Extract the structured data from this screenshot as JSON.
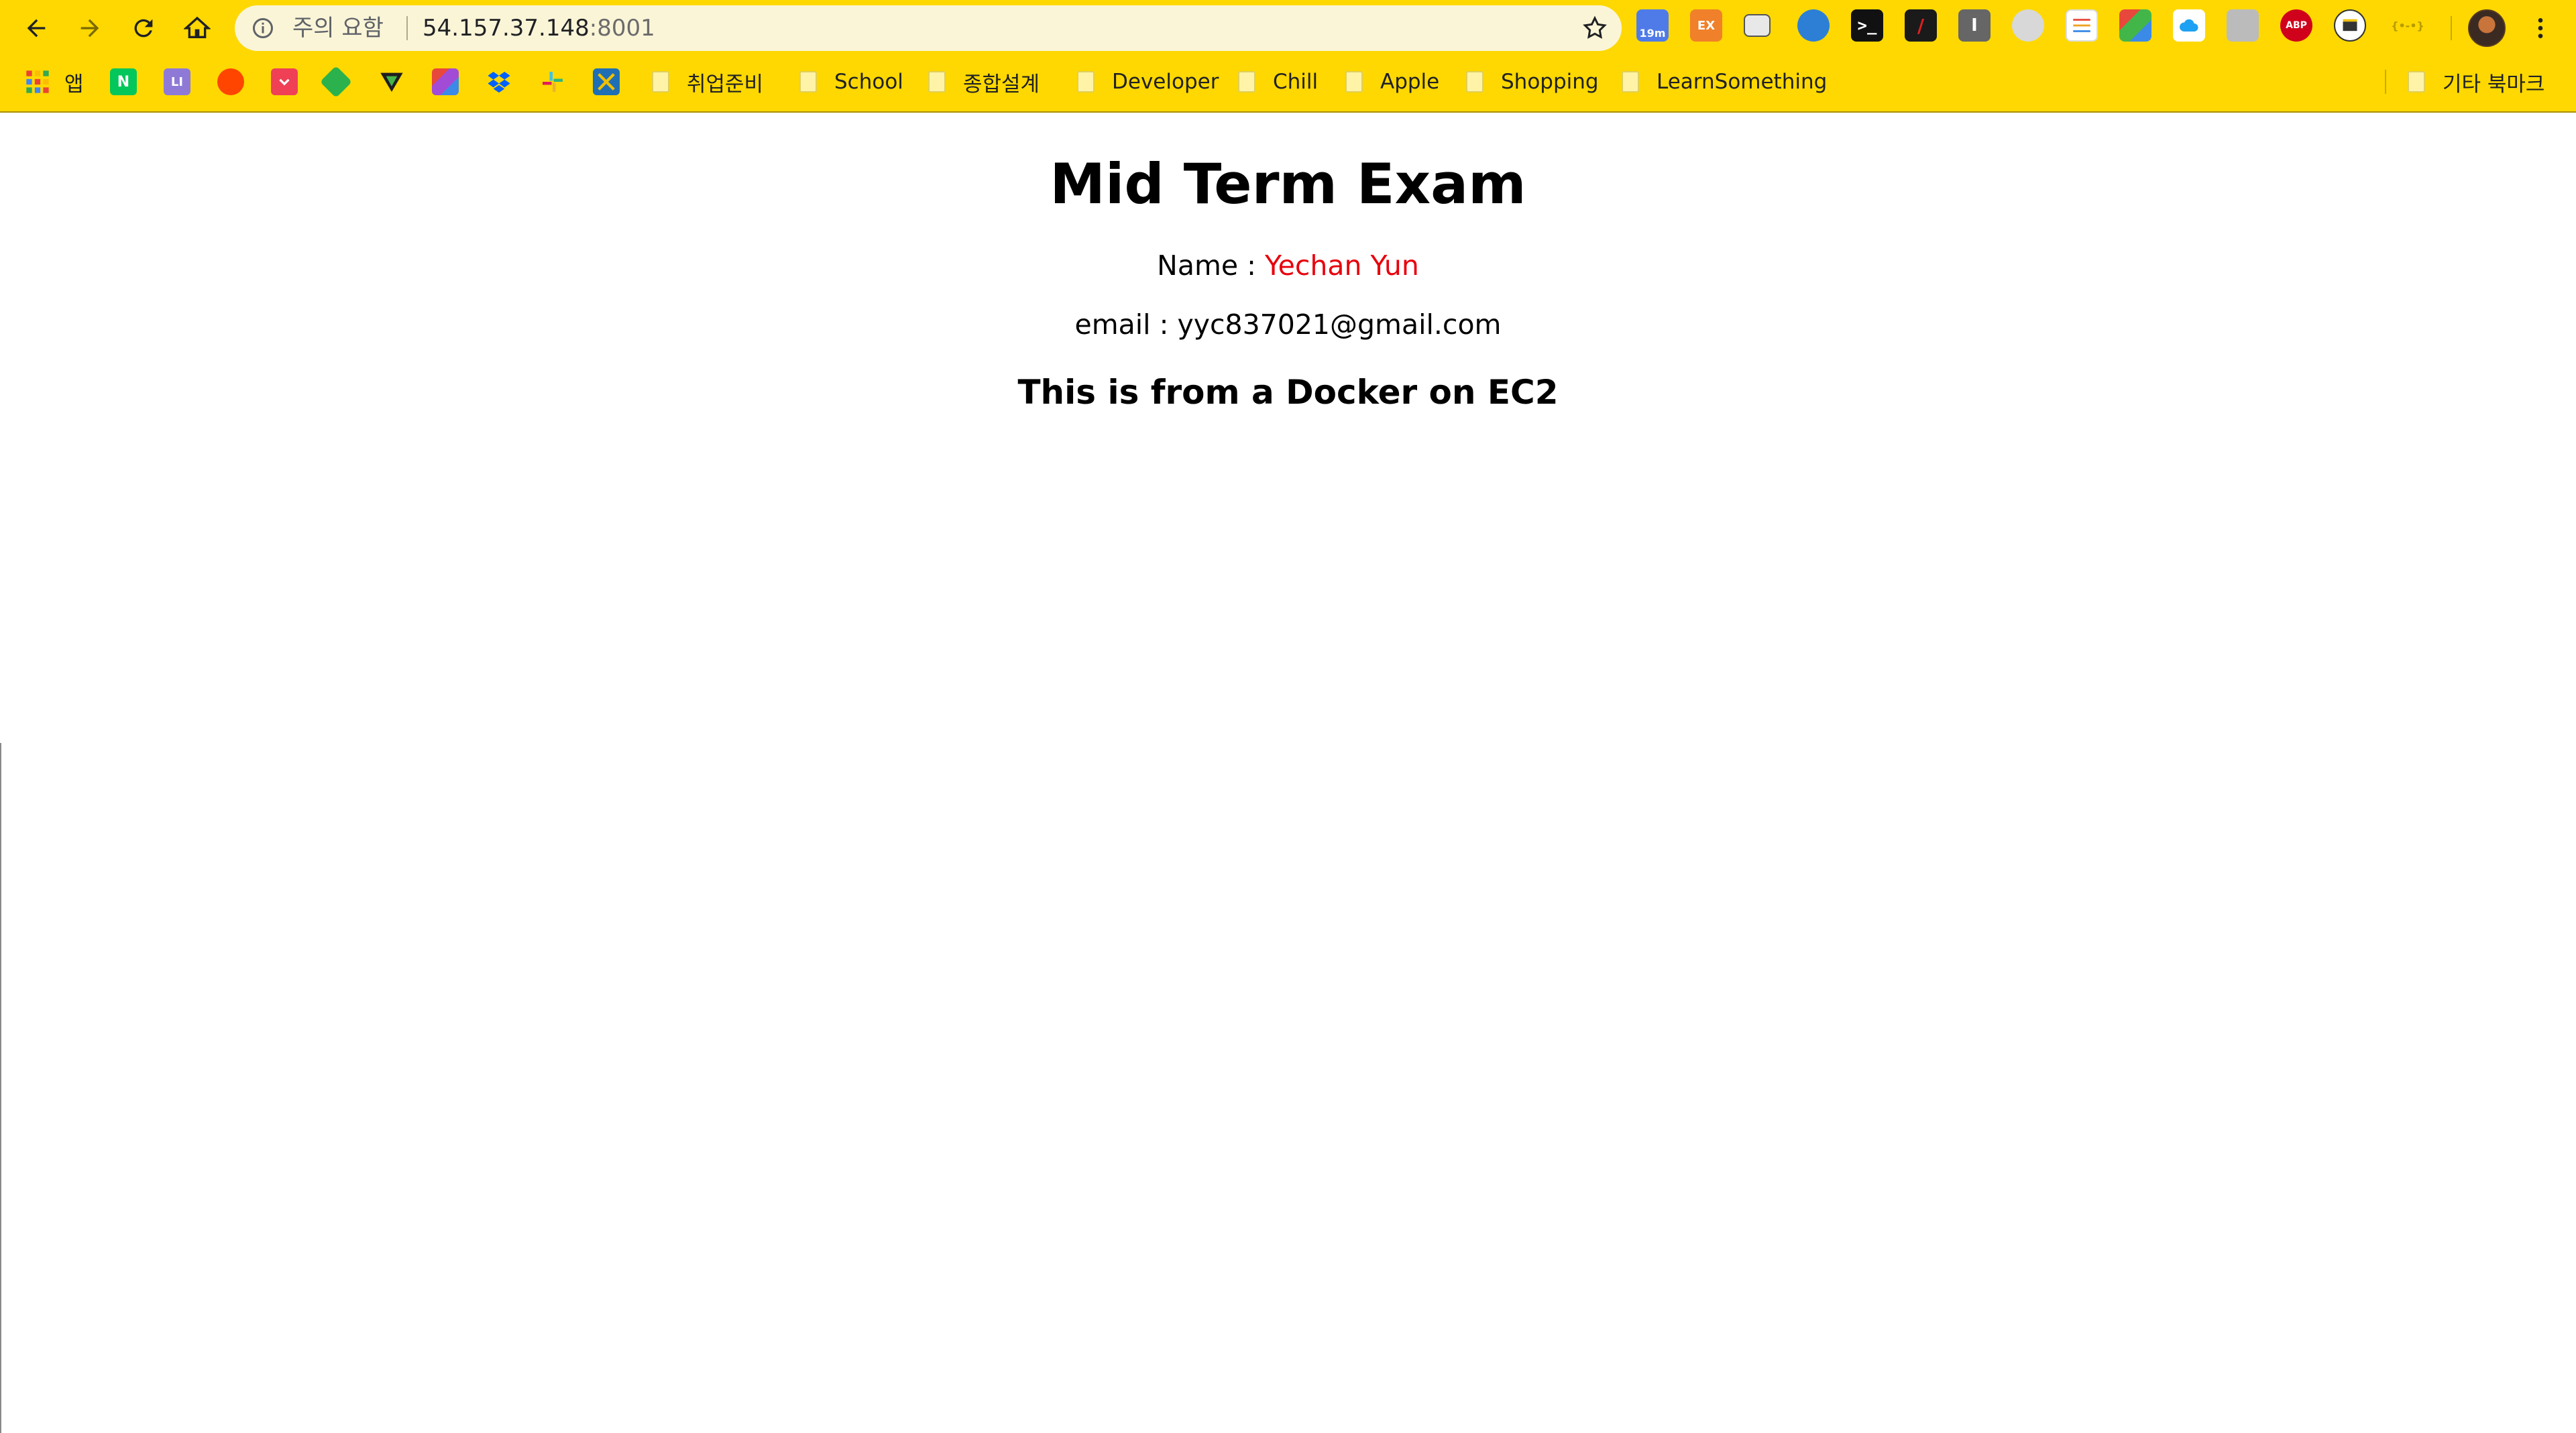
{
  "browser": {
    "omnibox": {
      "security_warning": "주의 요함",
      "url_host": "54.157.37.148",
      "url_port": ":8001"
    },
    "extensions": [
      {
        "icon": "calendar-icon",
        "badge": "19m",
        "color": "#4f7be8"
      },
      {
        "icon": "ex-icon",
        "label": "EX",
        "color": "#f0802a"
      },
      {
        "icon": "card-icon",
        "color": "#e8e8e8"
      },
      {
        "icon": "globe-icon",
        "color": "#2d7fd6"
      },
      {
        "icon": "terminal-icon",
        "color": "#111111"
      },
      {
        "icon": "slash-icon",
        "color": "#1a1a1a"
      },
      {
        "icon": "text-cursor-icon",
        "color": "#666666"
      },
      {
        "icon": "refresh-circle-icon",
        "color": "#9aa0a6"
      },
      {
        "icon": "sliders-icon",
        "color": "#ffffff"
      },
      {
        "icon": "palette-icon",
        "color": "#e8483c"
      },
      {
        "icon": "cloud-icon",
        "color": "#1ea1f2"
      },
      {
        "icon": "touch-icon",
        "color": "#bbbbbb"
      },
      {
        "icon": "adblock-icon",
        "label": "ABP",
        "color": "#d0021b"
      },
      {
        "icon": "movie-icon",
        "color": "#ffffff"
      },
      {
        "icon": "code-icon",
        "label": "{•-•}",
        "color": "#b79b00"
      }
    ],
    "bookmarks": {
      "apps_label": "앱",
      "folders": [
        "취업준비",
        "School",
        "종합설계",
        "Developer",
        "Chill",
        "Apple",
        "Shopping",
        "LearnSomething"
      ],
      "other_label": "기타 북마크"
    }
  },
  "page": {
    "title": "Mid Term Exam",
    "name_label": "Name : ",
    "name_value": "Yechan Yun",
    "email_label": "email : ",
    "email_value": "yyc837021@gmail.com",
    "subtitle": "This is from a Docker on EC2"
  }
}
